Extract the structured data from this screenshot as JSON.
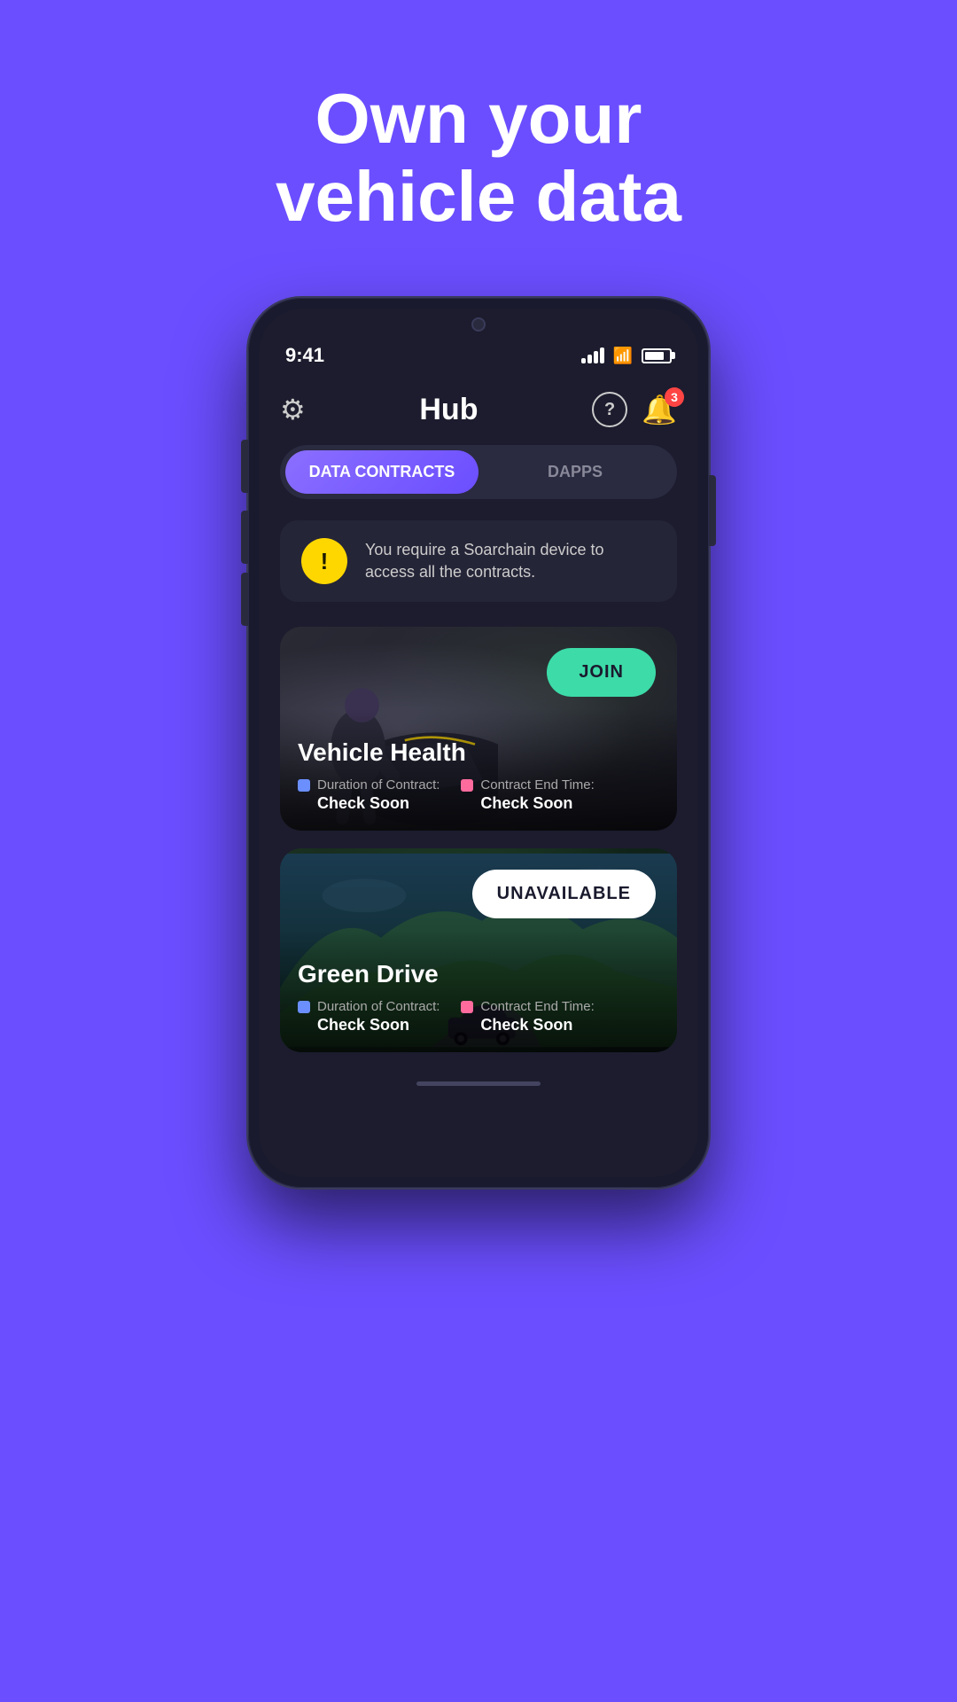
{
  "hero": {
    "title": "Own your\nvehicle data"
  },
  "statusBar": {
    "time": "9:41",
    "batteryPercent": 80
  },
  "header": {
    "title": "Hub",
    "notificationCount": "3"
  },
  "tabs": [
    {
      "label": "DATA CONTRACTS",
      "active": true
    },
    {
      "label": "DAPPS",
      "active": false
    }
  ],
  "warning": {
    "icon": "!",
    "text": "You require a Soarchain device to access all the contracts."
  },
  "contracts": [
    {
      "title": "Vehicle Health",
      "buttonLabel": "JOIN",
      "buttonType": "join",
      "durationLabel": "Duration of Contract:",
      "durationValue": "Check Soon",
      "endTimeLabel": "Contract End Time:",
      "endTimeValue": "Check Soon"
    },
    {
      "title": "Green Drive",
      "buttonLabel": "UNAVAILABLE",
      "buttonType": "unavailable",
      "durationLabel": "Duration of Contract:",
      "durationValue": "Check Soon",
      "endTimeLabel": "Contract End Time:",
      "endTimeValue": "Check Soon"
    }
  ]
}
